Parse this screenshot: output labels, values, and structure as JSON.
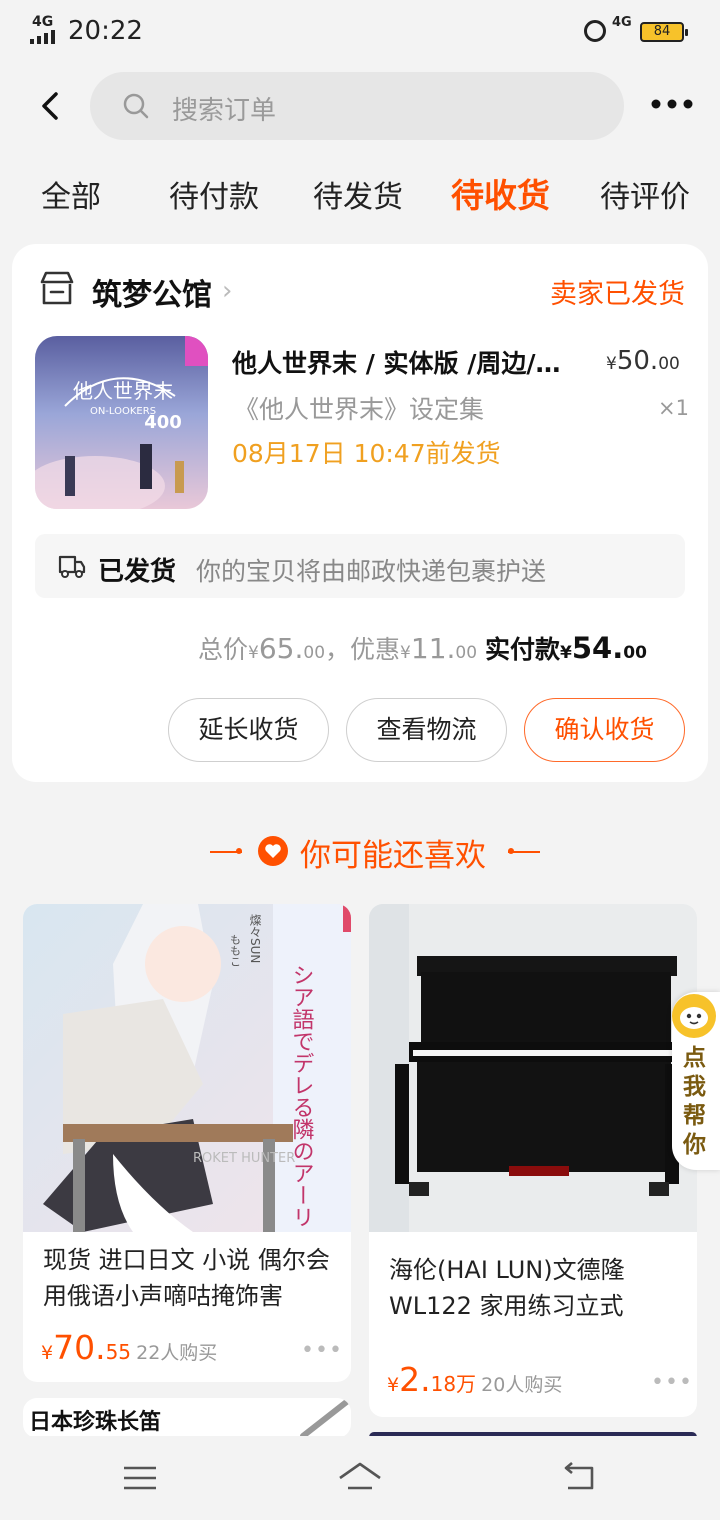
{
  "status_bar": {
    "signal": "4G",
    "time": "20:22",
    "network": "4G",
    "battery": "84"
  },
  "search": {
    "placeholder": "搜索订单"
  },
  "tabs": [
    {
      "label": "全部"
    },
    {
      "label": "待付款"
    },
    {
      "label": "待发货"
    },
    {
      "label": "待收货",
      "active": true
    },
    {
      "label": "待评价"
    }
  ],
  "order": {
    "shop_name": "筑梦公馆",
    "status": "卖家已发货",
    "item": {
      "title": "他人世界末 / 实体版 /周边/…",
      "subtitle": "《他人世界末》设定集",
      "ship_deadline": "08月17日 10:47前发货",
      "price_int": "50.",
      "price_dec": "00",
      "currency": "¥",
      "qty": "×1",
      "thumb_text": {
        "title": "他人世界末",
        "subtitle": "ON-LOOKERS",
        "number": "400"
      }
    },
    "shipping": {
      "label": "已发货",
      "desc": "你的宝贝将由邮政快递包裹护送"
    },
    "totals": {
      "total_label": "总价",
      "total_int": "65.",
      "total_dec": "00",
      "sep": "，",
      "discount_label": "优惠",
      "discount_int": "11.",
      "discount_dec": "00",
      "paid_label": "实付款",
      "paid_int": "54.",
      "paid_dec": "00"
    },
    "buttons": {
      "extend": "延长收货",
      "logistics": "查看物流",
      "confirm": "确认收货"
    }
  },
  "recommend": {
    "title": "你可能还喜欢",
    "products": [
      {
        "title": "现货 进口日文 小说 偶尔会用俄语小声嘀咕掩饰害",
        "price_int": "70.",
        "price_dec": "55",
        "buyers": "22人购买",
        "cover_text": {
          "author": "燦々SUN",
          "illust": "ももこ",
          "title": "シア語でデレる隣のアーリャさん",
          "brand": "ROKET HUNTER"
        }
      },
      {
        "title": "海伦(HAI LUN)文德隆WL122 家用练习立式",
        "price_int": "2.",
        "price_dec": "18万",
        "buyers": "20人购买"
      },
      {
        "title": "日本珍珠长笛"
      }
    ]
  },
  "helper": {
    "label": "点我帮你"
  },
  "colors": {
    "accent": "#ff5000",
    "ship_orange": "#f0a020",
    "battery": "#f7c22a"
  }
}
